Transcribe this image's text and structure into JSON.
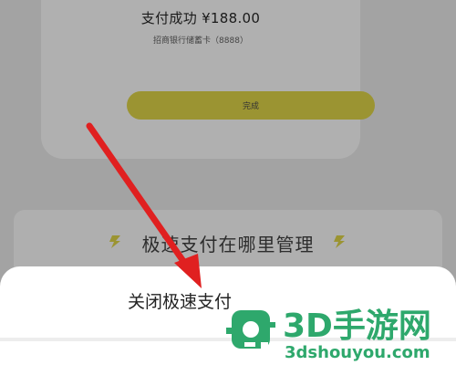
{
  "payment_card": {
    "title": "支付成功 ¥188.00",
    "subtitle": "招商银行储蓄卡（8888）",
    "done_label": "完成"
  },
  "faq": {
    "heading": "极速支付在哪里管理"
  },
  "bottom_sheet": {
    "option_label": "关闭极速支付"
  },
  "watermark": {
    "brand": "3D手游网",
    "url": "3dshouyou.com"
  },
  "icons": {
    "faq_left": "lightning-bolt-icon",
    "faq_right": "lightning-bolt-icon"
  },
  "colors": {
    "accent_yellow": "#9b9432",
    "overlay_gray": "#a3a3a3",
    "arrow_red": "#e02020",
    "watermark_green": "#2ea86c"
  }
}
